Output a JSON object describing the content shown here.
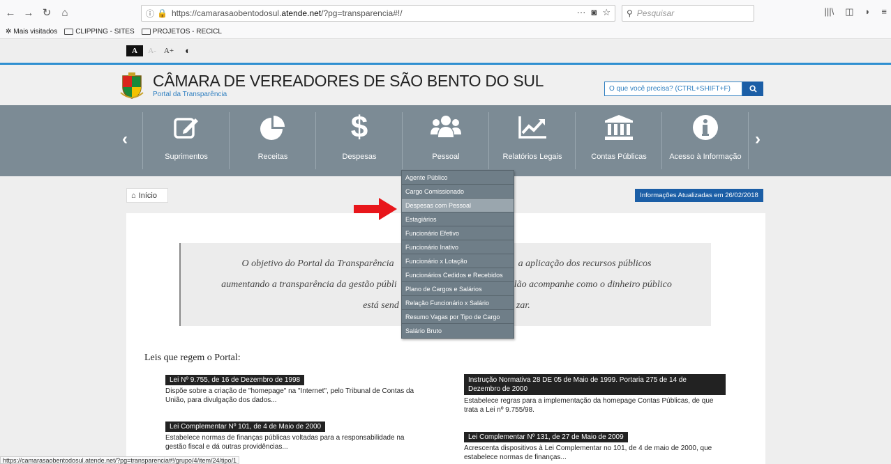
{
  "browser": {
    "url_prefix": "https://camarasaobentodosul.",
    "url_host": "atende.net",
    "url_suffix": "/?pg=transparencia#!/",
    "search_placeholder": "Pesquisar",
    "menu_dots": "···"
  },
  "bookmarks": [
    {
      "label": "Mais visitados"
    },
    {
      "label": "CLIPPING - SITES"
    },
    {
      "label": "PROJETOS - RECICL"
    }
  ],
  "a11y": {
    "normal": "A",
    "decrease": "A-",
    "increase": "A+"
  },
  "header": {
    "title": "CÂMARA DE VEREADORES DE SÃO BENTO DO SUL",
    "subtitle": "Portal da Transparência",
    "search_placeholder": "O que você precisa? (CTRL+SHIFT+F)"
  },
  "menu": {
    "items": [
      {
        "label": "Suprimentos",
        "icon": "edit-icon"
      },
      {
        "label": "Receitas",
        "icon": "pie-chart-icon"
      },
      {
        "label": "Despesas",
        "icon": "dollar-icon"
      },
      {
        "label": "Pessoal",
        "icon": "users-icon"
      },
      {
        "label": "Relatórios Legais",
        "icon": "line-chart-icon"
      },
      {
        "label": "Contas Públicas",
        "icon": "bank-icon"
      },
      {
        "label": "Acesso à Informação",
        "icon": "info-icon"
      }
    ]
  },
  "dropdown": {
    "items": [
      "Agente Público",
      "Cargo Comissionado",
      "Despesas com Pessoal",
      "Estagiários",
      "Funcionário Efetivo",
      "Funcionário Inativo",
      "Funcionário x Lotação",
      "Funcionários Cedidos e Recebidos",
      "Plano de Cargos e Salários",
      "Relação Funcionário x Salário",
      "Resumo Vagas por Tipo de Cargo",
      "Salário Bruto"
    ],
    "highlighted": "Despesas com Pessoal"
  },
  "breadcrumb": {
    "label": "Início"
  },
  "update_badge": "Informações Atualizadas em 26/02/2018",
  "quote": {
    "line1_left": "O objetivo do Portal da Transparência",
    "line1_right": "a aplicação dos recursos públicos",
    "line2_left": "aumentando a transparência da gestão públi",
    "line2_right": "lão acompanhe como o dinheiro público",
    "line3_left": "está send",
    "line3_right": "zar."
  },
  "leis": {
    "title": "Leis que regem o Portal:",
    "items": [
      {
        "tag": "Lei Nº 9.755, de 16 de Dezembro de 1998",
        "desc1": "Dispõe sobre a criação de \"homepage\" na \"Internet\", pelo Tribunal de Contas da",
        "desc2": "União, para divulgação dos dados..."
      },
      {
        "tag1": "Instrução Normativa 28 DE 05 de Maio de 1999. Portaria 275 de 14 de",
        "tag2": "Dezembro de 2000",
        "desc1": "Estabelece regras para a implementação da homepage Contas Públicas, de que",
        "desc2": "trata a Lei nº 9.755/98."
      },
      {
        "tag": "Lei Complementar Nº 101, de 4 de Maio de 2000",
        "desc1": "Estabelece normas de finanças públicas voltadas para a responsabilidade na",
        "desc2": "gestão fiscal e dá outras providências..."
      },
      {
        "tag": "Lei Complementar Nº 131, de 27 de Maio de 2009",
        "desc1": "Acrescenta dispositivos à Lei Complementar no 101, de 4 de maio de 2000, que",
        "desc2": "estabelece normas de finanças..."
      }
    ]
  },
  "statusbar": "https://camarasaobentodosul.atende.net/?pg=transparencia#!/grupo/4/item/24/tipo/1",
  "colors": {
    "accent": "#1b5ea6",
    "menu_bg": "#7c8b95",
    "arrow": "#e8161b"
  }
}
